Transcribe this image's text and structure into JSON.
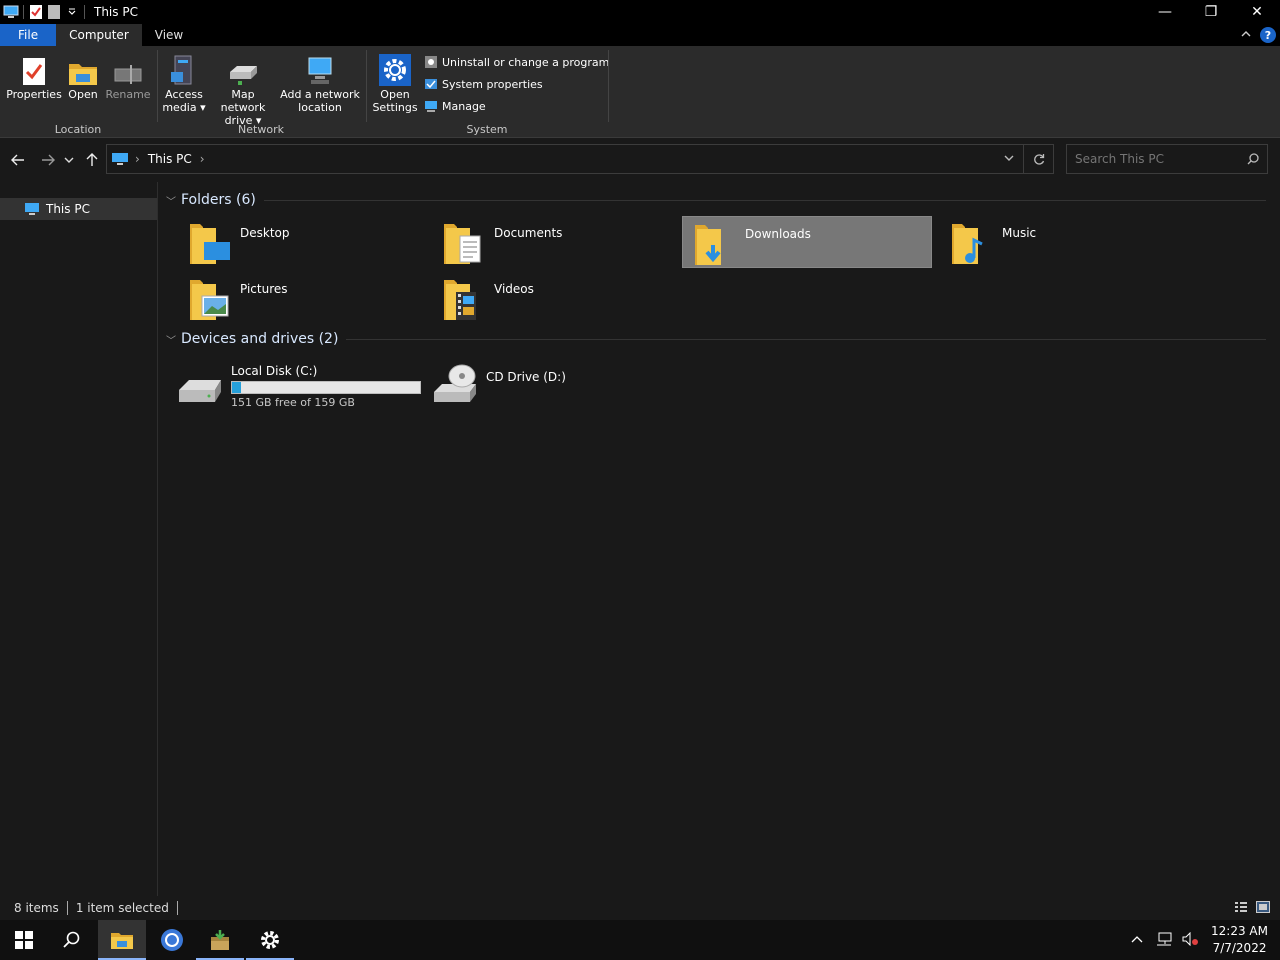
{
  "window": {
    "title": "This PC",
    "controls": {
      "minimize": "—",
      "maximize": "❐",
      "close": "✕"
    }
  },
  "ribbon": {
    "tabs": [
      {
        "label": "File"
      },
      {
        "label": "Computer"
      },
      {
        "label": "View"
      }
    ],
    "help": "?",
    "location": {
      "label": "Location",
      "properties": "Properties",
      "open": "Open",
      "rename": "Rename"
    },
    "network": {
      "label": "Network",
      "access_media_1": "Access",
      "access_media_2": "media",
      "map_drive_1": "Map network",
      "map_drive_2": "drive",
      "add_location_1": "Add a network",
      "add_location_2": "location"
    },
    "system": {
      "label": "System",
      "open_settings_1": "Open",
      "open_settings_2": "Settings",
      "uninstall": "Uninstall or change a program",
      "system_properties": "System properties",
      "manage": "Manage"
    }
  },
  "address": {
    "path": "This PC",
    "search_placeholder": "Search This PC"
  },
  "nav": {
    "items": [
      {
        "label": "This PC"
      }
    ]
  },
  "folders": {
    "heading": "Folders (6)",
    "items": [
      {
        "label": "Desktop"
      },
      {
        "label": "Documents"
      },
      {
        "label": "Downloads"
      },
      {
        "label": "Music"
      },
      {
        "label": "Pictures"
      },
      {
        "label": "Videos"
      }
    ]
  },
  "drives": {
    "heading": "Devices and drives (2)",
    "items": [
      {
        "label": "Local Disk (C:)",
        "free_text": "151 GB free of 159 GB",
        "used_fraction": 0.05
      },
      {
        "label": "CD Drive (D:)"
      }
    ]
  },
  "status": {
    "items_count": "8 items",
    "selected": "1 item selected"
  },
  "taskbar": {
    "time": "12:23 AM",
    "date": "7/7/2022"
  },
  "colors": {
    "accent": "#1a64c8",
    "folder": "#f0c24a",
    "drive_bar": "#26a0da"
  }
}
